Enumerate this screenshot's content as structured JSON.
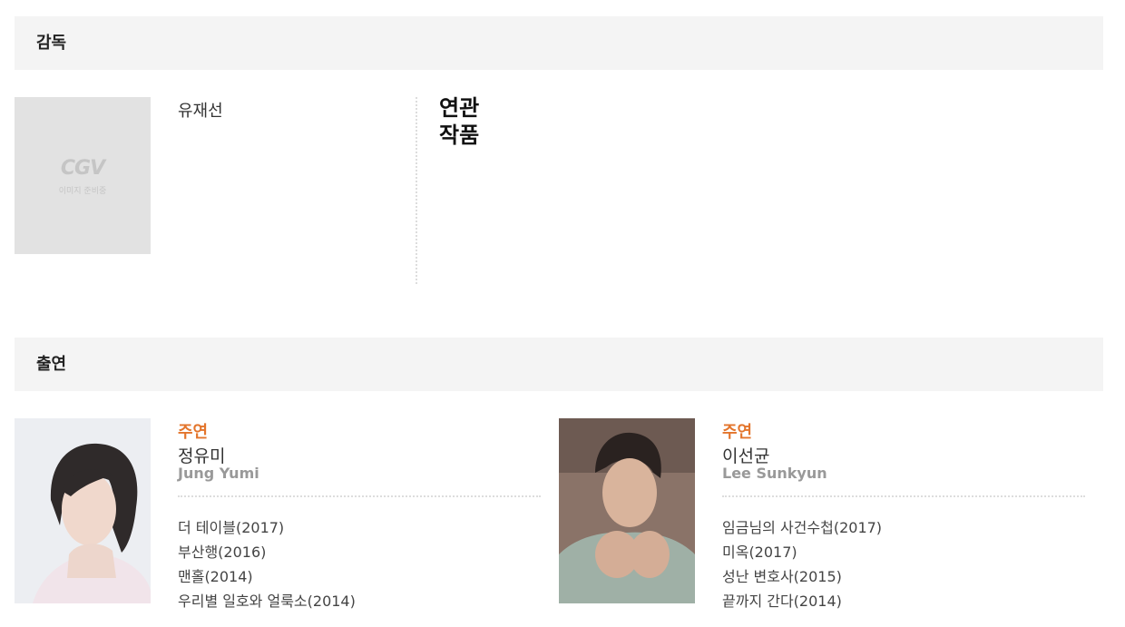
{
  "director_section": {
    "title": "감독",
    "placeholder_logo": "CGV",
    "placeholder_text": "이미지 준비중",
    "name": "유재선",
    "related_label": "연관 작품"
  },
  "cast_section": {
    "title": "출연",
    "actors": [
      {
        "role": "주연",
        "name": "정유미",
        "name_en": "Jung Yumi",
        "works": [
          "더 테이블(2017)",
          "부산행(2016)",
          "맨홀(2014)",
          "우리별 일호와 얼룩소(2014)"
        ]
      },
      {
        "role": "주연",
        "name": "이선균",
        "name_en": "Lee Sunkyun",
        "works": [
          "임금님의 사건수첩(2017)",
          "미옥(2017)",
          "성난 변호사(2015)",
          "끝까지 간다(2014)"
        ]
      }
    ]
  },
  "colors": {
    "accent": "#e3752c",
    "section_bg": "#f4f4f4",
    "placeholder_bg": "#e2e2e2"
  }
}
